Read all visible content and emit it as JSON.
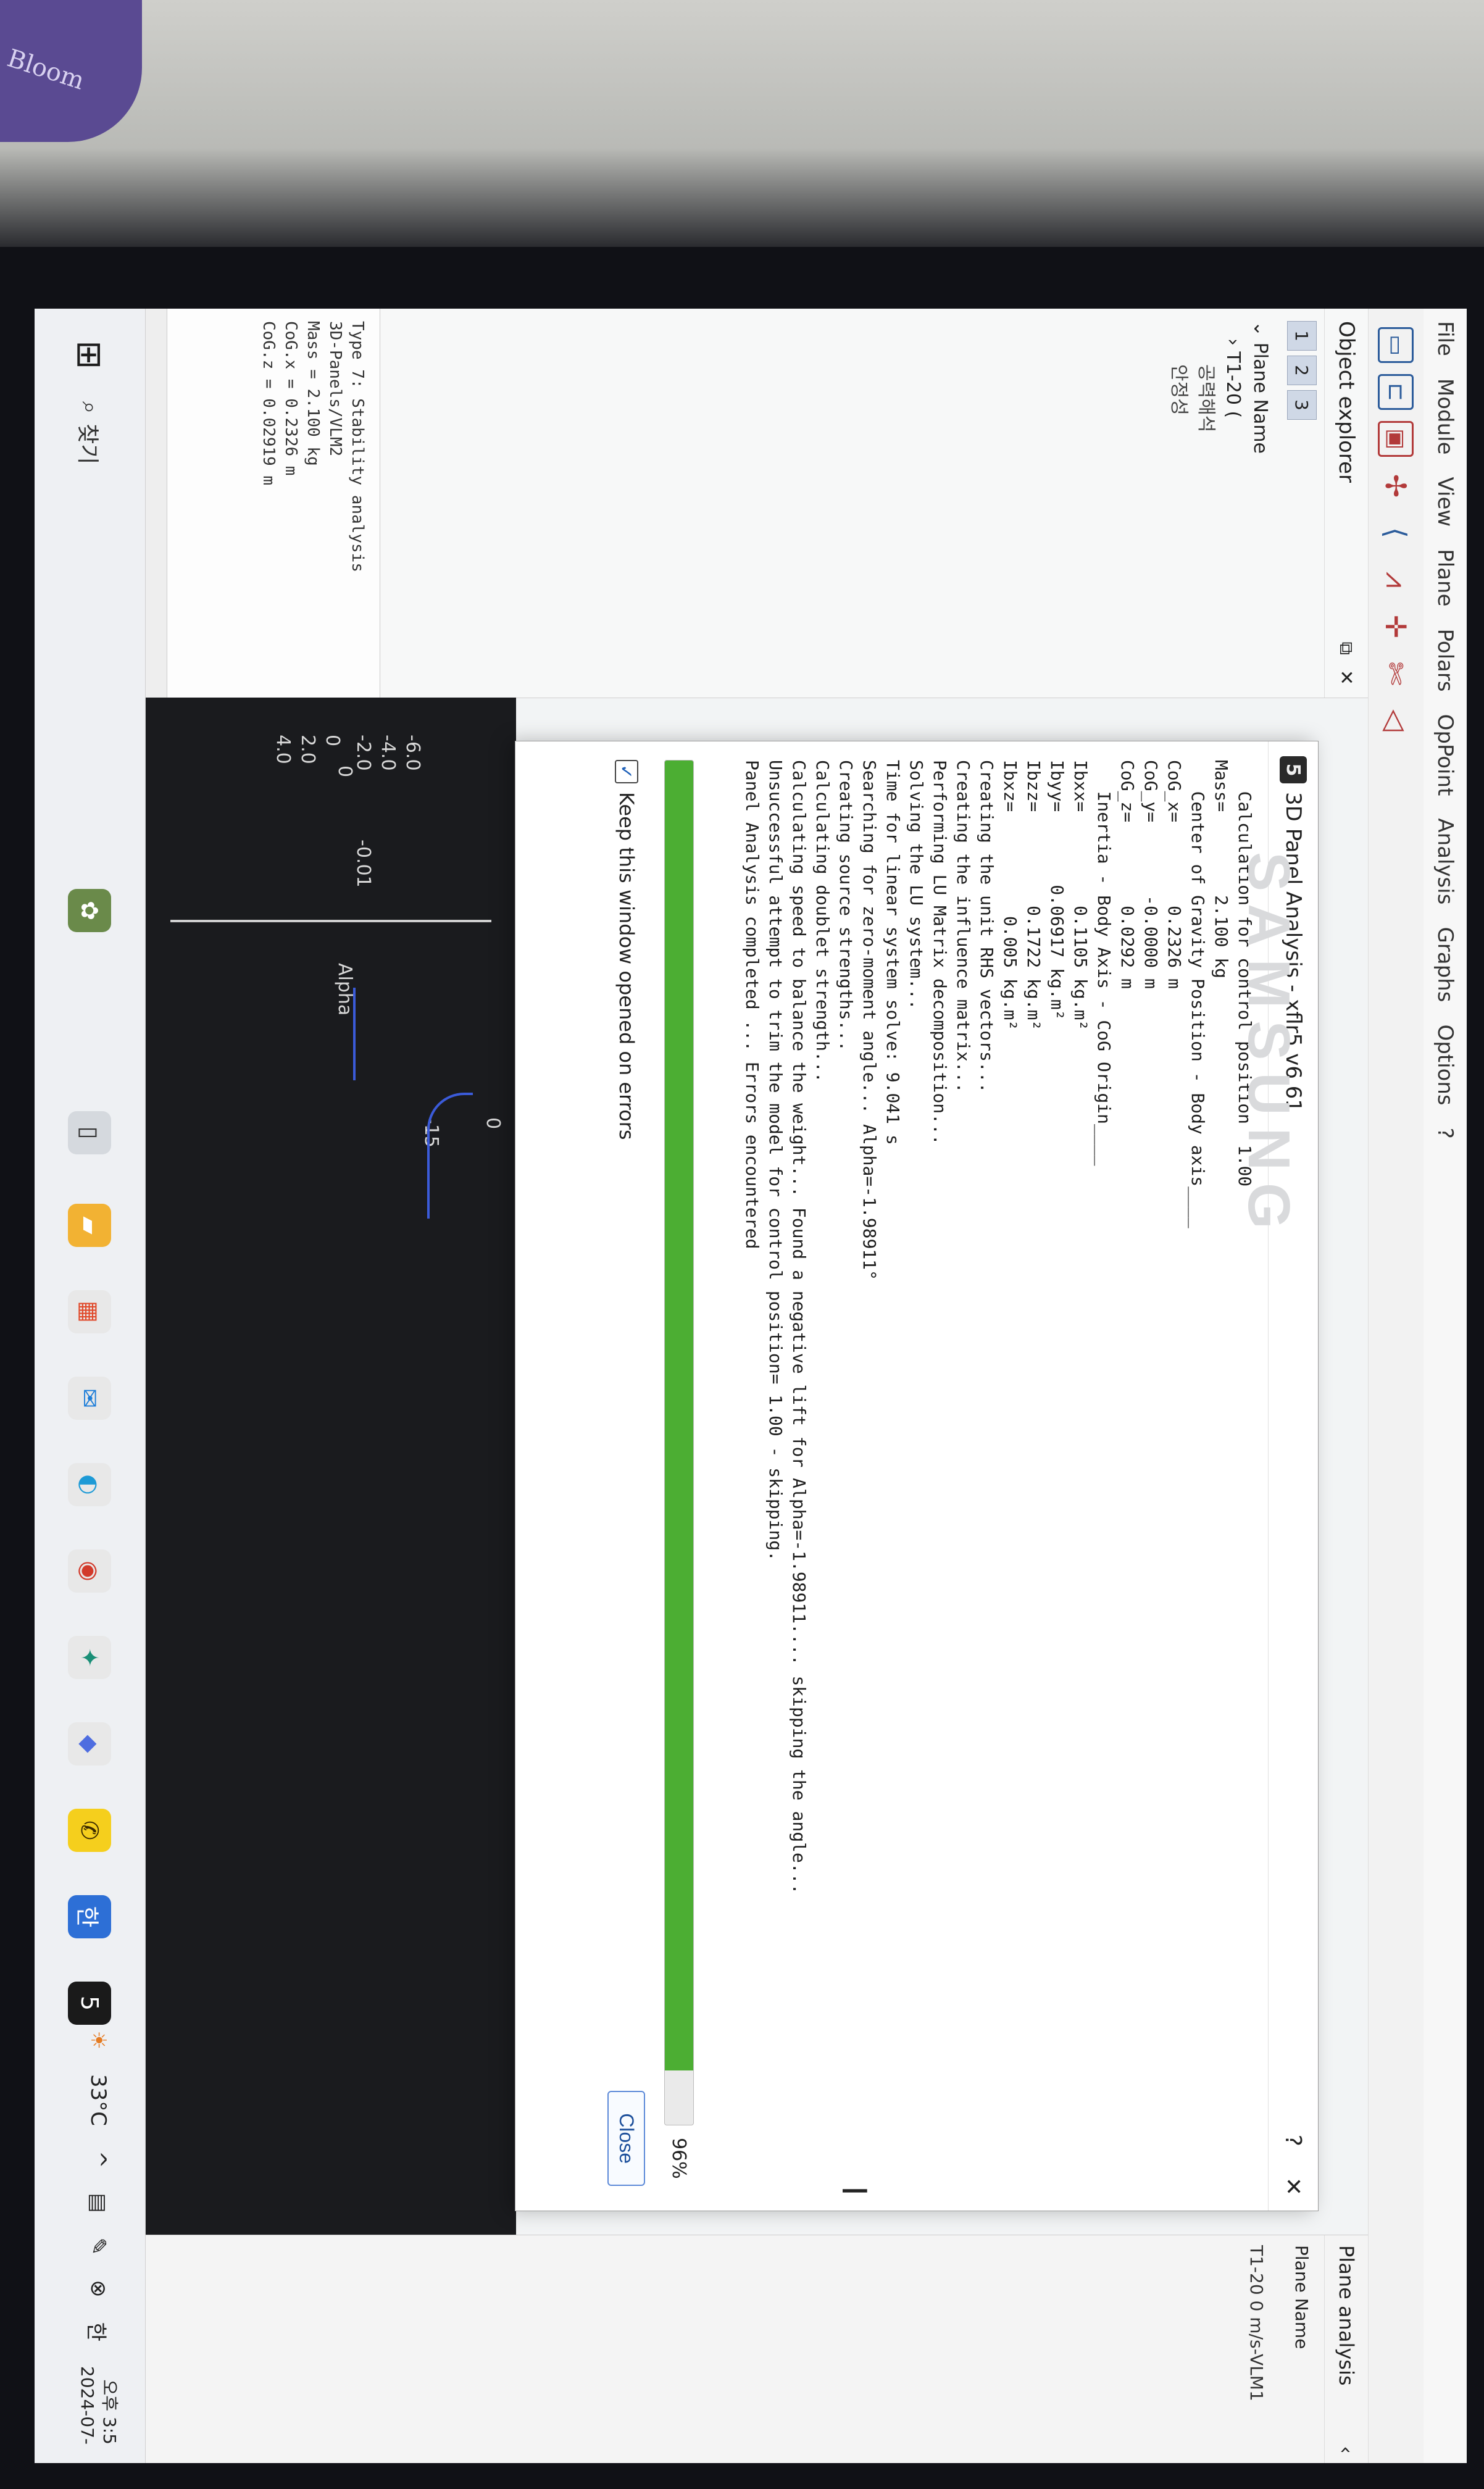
{
  "menu": [
    "File",
    "Module",
    "View",
    "Plane",
    "Polars",
    "OpPoint",
    "Analysis",
    "Graphs",
    "Options",
    "?"
  ],
  "explorer": {
    "title": "Object explorer",
    "tabs": [
      "1",
      "2",
      "3"
    ],
    "tree": {
      "root": "Plane Name",
      "child": "T1-20 (",
      "sub1": "공력해석",
      "sub2": "안정성"
    },
    "info": {
      "line1": "Type 7: Stability analysis",
      "line2": "3D-Panels/VLM2",
      "line3": "Mass =     2.100 kg",
      "line4": "CoG.x =    0.2326 m",
      "line5": "CoG.z = 0.02919 m"
    }
  },
  "right_panel": {
    "title": "Plane analysis",
    "label": "Plane Name",
    "value": "T1-20 0 m/s-VLM1"
  },
  "dialog": {
    "title": "3D Panel Analysis - xflr5 v6.61",
    "help": "?",
    "close_x": "✕",
    "log": {
      "l01": "   Calculation for control position  1.00",
      "l02": "Mass=        2.100 kg",
      "l03": "",
      "l04": "   Center of Gravity Position - Body axis____",
      "l05": "CoG_x=        0.2326 m",
      "l06": "CoG_y=       -0.0000 m",
      "l07": "CoG_z=        0.0292 m",
      "l08": "",
      "l09": "   Inertia - Body Axis - CoG Origin____",
      "l10": "Ibxx=         0.1105 kg.m²",
      "l11": "Ibyy=       0.06917 kg.m²",
      "l12": "Ibzz=         0.1722 kg.m²",
      "l13": "Ibxz=          0.005 kg.m²",
      "l14": "",
      "l15": "",
      "l16": "Creating the unit RHS vectors...",
      "l17": "Creating the influence matrix...",
      "l18": "Performing LU Matrix decomposition...",
      "l19": "Solving the LU system...",
      "l20": "Time for linear system solve: 9.041 s",
      "l21": "Searching for zero-moment angle... Alpha=-1.98911°",
      "l22": "Creating source strengths...",
      "l23": "Calculating doublet strength...",
      "l24": "Calculating speed to balance the weight... Found a negative lift for Alpha=-1.98911.... skipping the angle...",
      "l25": "Unsuccessful attempt to trim the model for control position= 1.00 - skipping.",
      "l26": "",
      "l27": "",
      "l28": "Panel Analysis completed ... Errors encountered"
    },
    "progress_percent": "96%",
    "progress_value": 0.96,
    "keep_open": "Keep this window opened on errors",
    "close_button": "Close"
  },
  "graph": {
    "ticks": [
      "-6.0",
      "-4.0",
      "-2.0",
      "0",
      "2.0",
      "4.0"
    ],
    "zero_label": "0",
    "y_tick": "-0.01",
    "alpha_label": "Alpha",
    "right_tick1": "0",
    "right_tick2": "-15"
  },
  "taskbar": {
    "search": "찾기",
    "weather": "33°C",
    "lang": "한",
    "time": "오후 3:5",
    "date": "2024-07-"
  },
  "bezel": {
    "brand": "SAMSUNG"
  },
  "desk": {
    "sticker": "Bloom"
  },
  "colors": {
    "accent": "#4cae33",
    "dialog_bg": "#ffffff",
    "graph_bg": "#1a1b1e"
  }
}
